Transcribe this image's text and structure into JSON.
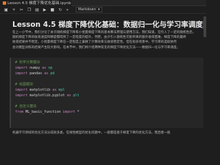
{
  "tab": {
    "title": "Lesson 4.5 梯度下降优化基础.ipynb",
    "close_glyph": "×"
  },
  "toolbar": {
    "cell_type": "Markdown",
    "icons": [
      "save-icon",
      "add-cell-icon",
      "cut-icon",
      "copy-icon",
      "paste-icon",
      "run-icon",
      "stop-icon",
      "restart-icon",
      "fast-forward-icon"
    ]
  },
  "notebook": {
    "heading_main": "Lesson 4.5 梯度下降优化基础：数据归一化与学习率调度",
    "heading_highlight": "1",
    "intro_lines": [
      "在上一小节中，我们讨论了关于随机梯度下降和小批量梯度下降的基本算法原理与使用方法。我们知道，在引入了一定的随机性后，",
      "随机梯度下降的收敛速度和精度都得到了一定程度的提升，然而，由于引入随机性可能带来的额外收敛困难，梯度下降的最终",
      "收敛结果并不稳定。小批量梯度下降在一定程度上兼顾了计算效率与收敛稳定性，但在很多场景中，学习率的选取依然",
      "会对模型训练的结果产生较大影响。在本节中，我们将介绍两种常见的梯度下降优化方法——数据归一化与学习率调度。"
    ],
    "code_lines": [
      {
        "text": "# 科学计算模块",
        "kind": "comment"
      },
      {
        "text": "import numpy as np",
        "kind": "code"
      },
      {
        "text": "import pandas as pd",
        "kind": "code"
      },
      {
        "text": "",
        "kind": "code"
      },
      {
        "text": "# 绘图模块",
        "kind": "comment"
      },
      {
        "text": "import matplotlib as mpl",
        "kind": "code"
      },
      {
        "text": "import matplotlib.pyplot as plt",
        "kind": "code"
      },
      {
        "text": "",
        "kind": "code"
      },
      {
        "text": "# 自定义模块",
        "kind": "comment"
      },
      {
        "text": "from ML_basic_function import *",
        "kind": "code"
      }
    ],
    "bottom_line": "机器学习领域的优化方法分成很多类，在线性模型的优化问题中，一般都是基于梯度下降的优化方法。而后者一般"
  }
}
